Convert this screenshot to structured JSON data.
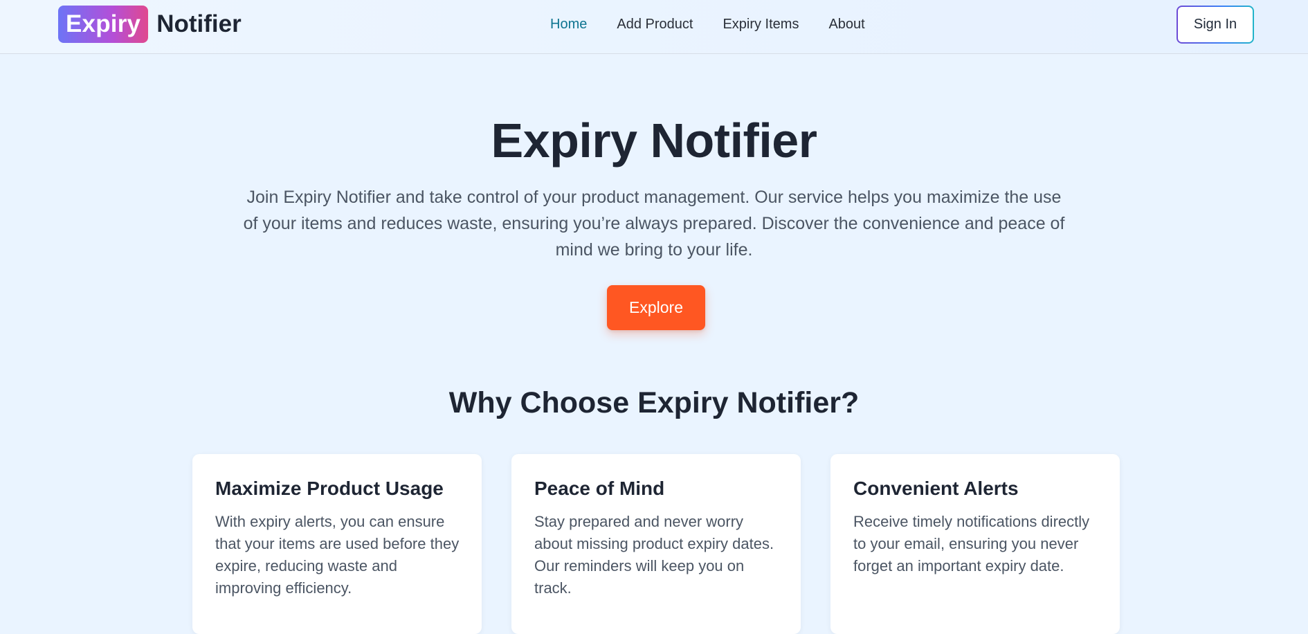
{
  "header": {
    "brand_badge": "Expiry",
    "brand_text": "Notifier",
    "nav": [
      {
        "label": "Home"
      },
      {
        "label": "Add Product"
      },
      {
        "label": "Expiry Items"
      },
      {
        "label": "About"
      }
    ],
    "active_nav": "Home",
    "signin_label": "Sign In"
  },
  "hero": {
    "title": "Expiry Notifier",
    "description": "Join Expiry Notifier and take control of your product management. Our service helps you maximize the use of your items and reduces waste, ensuring you’re always prepared. Discover the convenience and peace of mind we bring to your life.",
    "cta_label": "Explore"
  },
  "features": {
    "title": "Why Choose Expiry Notifier?",
    "cards": [
      {
        "title": "Maximize Product Usage",
        "text": "With expiry alerts, you can ensure that your items are used before they expire, reducing waste and improving efficiency."
      },
      {
        "title": "Peace of Mind",
        "text": "Stay prepared and never worry about missing product expiry dates. Our reminders will keep you on track."
      },
      {
        "title": "Convenient Alerts",
        "text": "Receive timely notifications directly to your email, ensuring you never forget an important expiry date."
      }
    ]
  },
  "colors": {
    "background": "#eaf4ff",
    "accent_orange": "#ff5722",
    "active_link": "#0e7490",
    "brand_gradient_start": "#6d74f6",
    "brand_gradient_end": "#e0498f"
  }
}
